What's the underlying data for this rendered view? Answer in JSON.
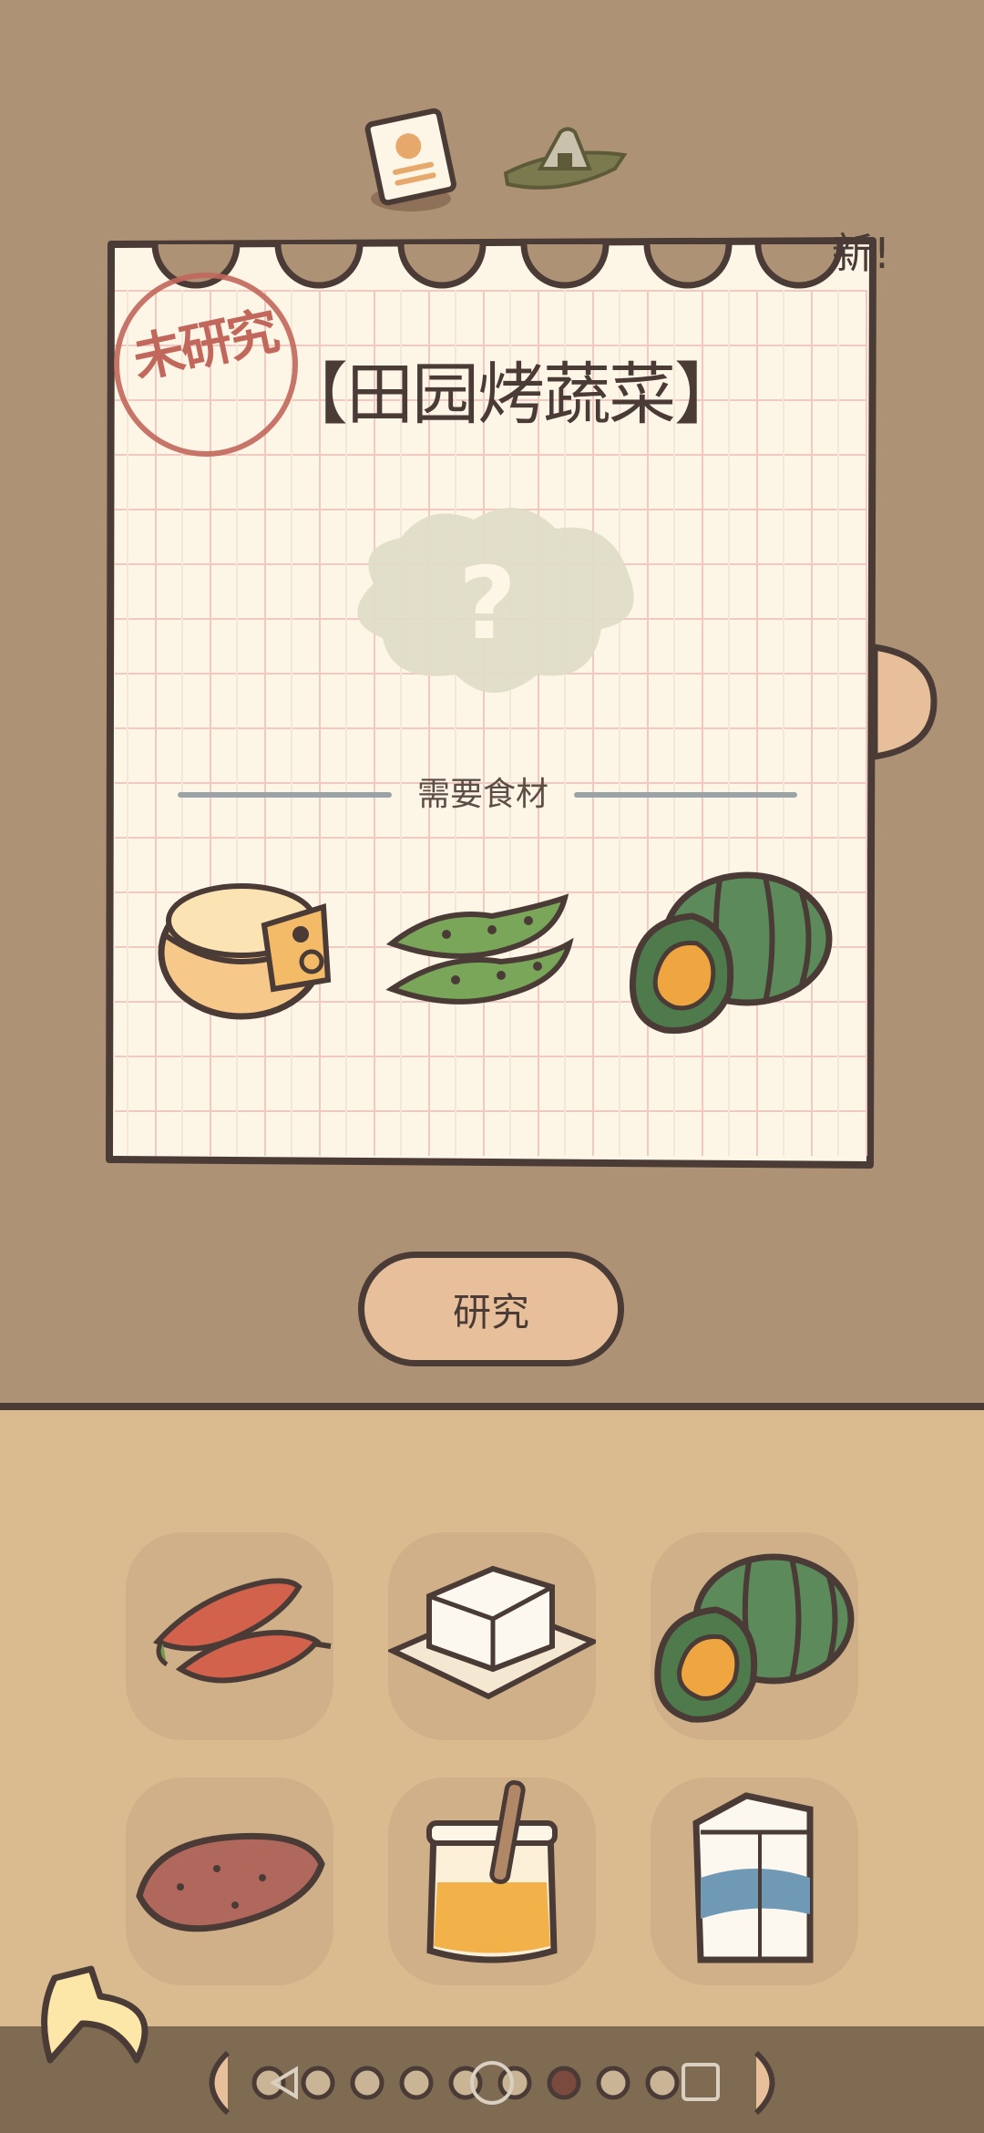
{
  "card": {
    "title": "【田园烤蔬菜】",
    "stamp": "未研究",
    "new_badge": "新!",
    "ingredients_label": "需要食材",
    "unknown_symbol": "?"
  },
  "ingredients": [
    {
      "name": "cheese-icon"
    },
    {
      "name": "edamame-icon"
    },
    {
      "name": "pumpkin-icon"
    }
  ],
  "research_button": {
    "label": "研究"
  },
  "pantry": {
    "items": [
      {
        "icon": "chili-pepper-icon"
      },
      {
        "icon": "tofu-icon"
      },
      {
        "icon": "pumpkin-icon"
      },
      {
        "icon": "sweet-potato-icon"
      },
      {
        "icon": "honey-jar-icon"
      },
      {
        "icon": "milk-carton-icon"
      }
    ]
  },
  "page_indicator": {
    "total": 9,
    "current": 7
  },
  "colors": {
    "background": "#ad9276",
    "card_paper": "#fdf6e6",
    "outline": "#4a3b36",
    "stamp": "#c2675b",
    "button": "#e7c09b",
    "pantry": "#d9bb8f"
  }
}
